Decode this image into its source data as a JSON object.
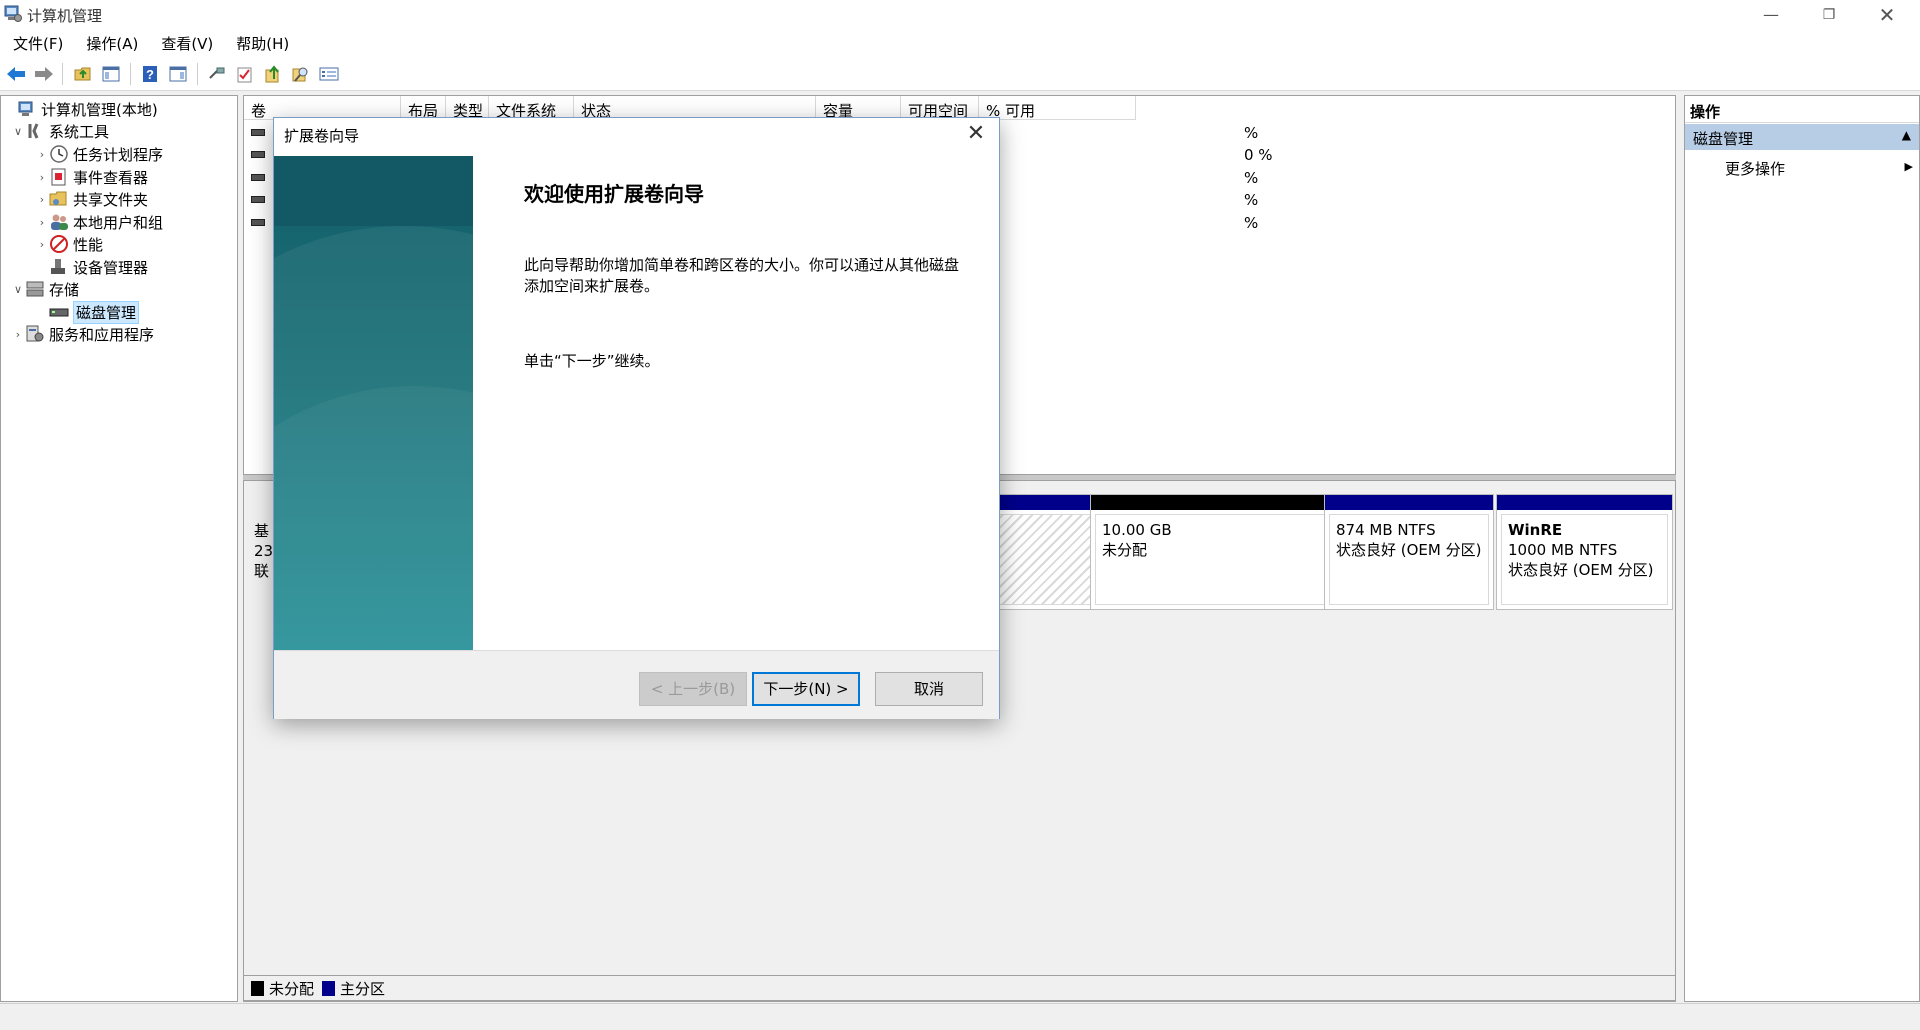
{
  "window": {
    "title": "计算机管理"
  },
  "menu": [
    "文件(F)",
    "操作(A)",
    "查看(V)",
    "帮助(H)"
  ],
  "tree": {
    "root": "计算机管理(本地)",
    "system_tools": "系统工具",
    "task_scheduler": "任务计划程序",
    "event_viewer": "事件查看器",
    "shared_folders": "共享文件夹",
    "local_users": "本地用户和组",
    "performance": "性能",
    "device_manager": "设备管理器",
    "storage": "存储",
    "disk_management": "磁盘管理",
    "services": "服务和应用程序"
  },
  "volume_table": {
    "columns": [
      "卷",
      "布局",
      "类型",
      "文件系统",
      "状态",
      "容量",
      "可用空间",
      "% 可用"
    ],
    "rows_pct": [
      "%",
      "0 %",
      "%",
      "%",
      "%"
    ]
  },
  "disk": {
    "label_lines": [
      "基",
      "23",
      "联"
    ],
    "partitions": [
      {
        "name": "",
        "size": "",
        "status": ""
      },
      {
        "name": "",
        "size": "10.00 GB",
        "status": "未分配"
      },
      {
        "name": "",
        "size": "874 MB NTFS",
        "status": "状态良好 (OEM 分区)"
      },
      {
        "name": "WinRE",
        "size": "1000 MB NTFS",
        "status": "状态良好 (OEM 分区)"
      }
    ]
  },
  "legend": {
    "unallocated": "未分配",
    "primary": "主分区"
  },
  "actions": {
    "header": "操作",
    "section": "磁盘管理",
    "more": "更多操作"
  },
  "dialog": {
    "title": "扩展卷向导",
    "heading": "欢迎使用扩展卷向导",
    "description": "此向导帮助你增加简单卷和跨区卷的大小。你可以通过从其他磁盘添加空间来扩展卷。",
    "hint": "单击“下一步”继续。",
    "back_label": "< 上一步(B)",
    "next_label": "下一步(N) >",
    "cancel_label": "取消"
  },
  "colors": {
    "unallocated": "#000000",
    "primary_partition": "#00008b",
    "selection": "#cce8ff",
    "action_section": "#b7cde6",
    "focus": "#0078d7"
  }
}
